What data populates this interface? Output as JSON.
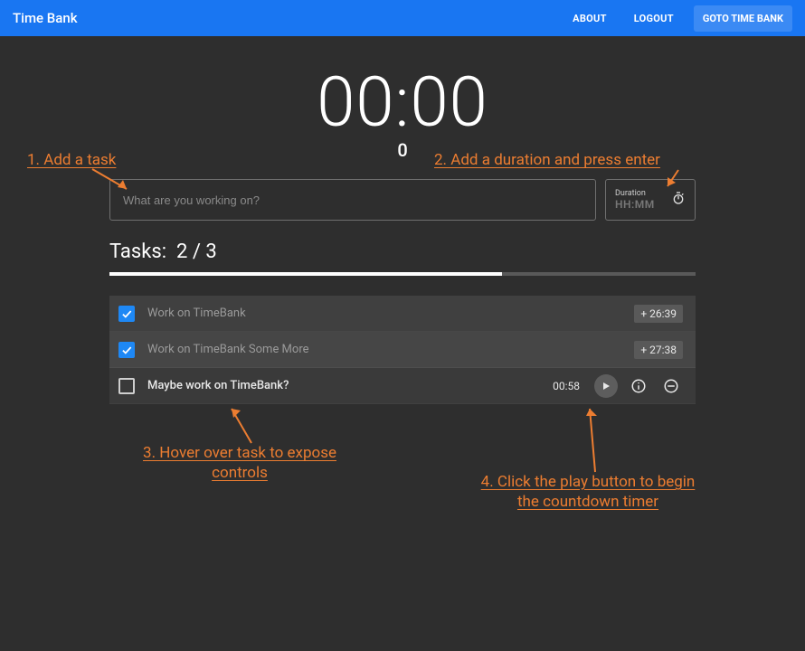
{
  "header": {
    "app_title": "Time Bank",
    "about": "ABOUT",
    "logout": "LOGOUT",
    "goto": "GOTO TIME BANK"
  },
  "timer": {
    "display": "00:00",
    "sub": "0"
  },
  "inputs": {
    "task_placeholder": "What are you working on?",
    "duration_label": "Duration",
    "duration_placeholder": "HH:MM"
  },
  "tasks_header": {
    "label": "Tasks:",
    "count": "2 / 3"
  },
  "tasks": [
    {
      "checked": true,
      "label": "Work on TimeBank",
      "badge": "+ 26:39"
    },
    {
      "checked": true,
      "label": "Work on TimeBank Some More",
      "badge": "+ 27:38"
    },
    {
      "checked": false,
      "label": "Maybe work on TimeBank?",
      "time": "00:58"
    }
  ],
  "callouts": {
    "c1": "1. Add a task",
    "c2": "2. Add a duration and press enter",
    "c3_l1": "3. Hover over task to expose",
    "c3_l2": "controls",
    "c4_l1": "4. Click the play button to begin",
    "c4_l2": "the countdown timer"
  }
}
